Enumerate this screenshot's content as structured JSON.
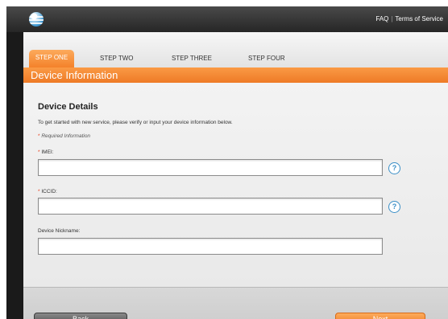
{
  "header": {
    "logo_icon": "att-globe-icon",
    "links": {
      "faq": "FAQ",
      "separator": "|",
      "terms": "Terms of Service"
    }
  },
  "steps": [
    {
      "label": "STEP ONE",
      "active": true
    },
    {
      "label": "STEP TWO",
      "active": false
    },
    {
      "label": "STEP THREE",
      "active": false
    },
    {
      "label": "STEP FOUR",
      "active": false
    }
  ],
  "section_title": "Device Information",
  "form": {
    "heading": "Device Details",
    "intro": "To get started with new service, please verify or input your device information below.",
    "required_marker": "*",
    "required_note": "Required Information",
    "fields": {
      "imei": {
        "label": "IMEI:",
        "required": true,
        "value": "",
        "help_icon": "question-mark-icon",
        "help_text": "?"
      },
      "iccid": {
        "label": "ICCID:",
        "required": true,
        "value": "",
        "help_icon": "question-mark-icon",
        "help_text": "?"
      },
      "nickname": {
        "label": "Device Nickname:",
        "required": false,
        "value": ""
      }
    }
  },
  "buttons": {
    "back": "Back",
    "next": "Next"
  },
  "colors": {
    "accent": "#f4822a",
    "help_blue": "#3a8fc7",
    "required_red": "#e8401c",
    "header_dark": "#262626"
  }
}
